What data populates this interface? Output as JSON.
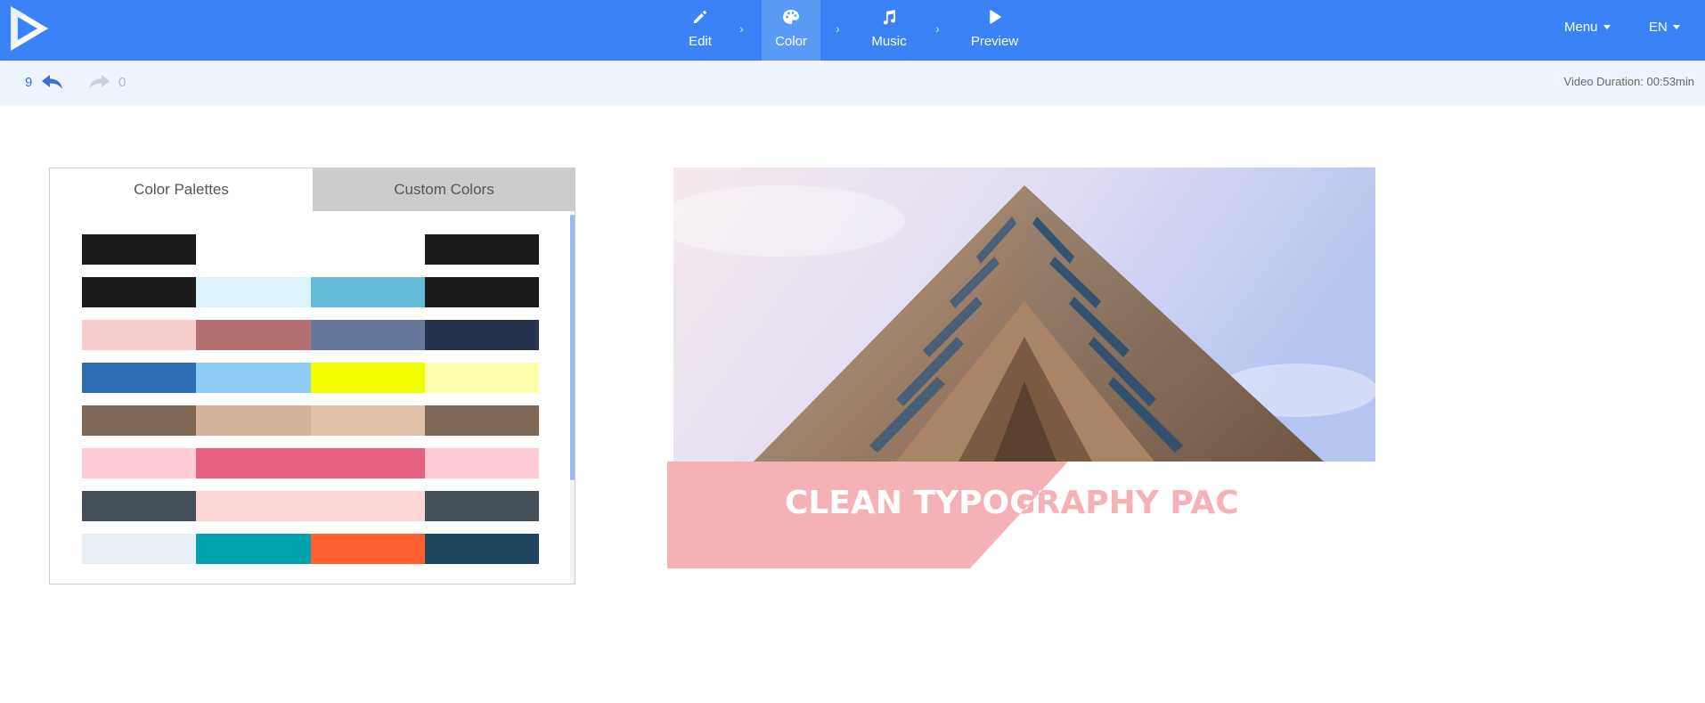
{
  "app": {
    "steps": [
      {
        "label": "Edit",
        "icon": "pencil-icon",
        "active": false
      },
      {
        "label": "Color",
        "icon": "palette-icon",
        "active": true
      },
      {
        "label": "Music",
        "icon": "music-note-icon",
        "active": false
      },
      {
        "label": "Preview",
        "icon": "play-icon",
        "active": false
      }
    ],
    "menu_label": "Menu",
    "language_label": "EN",
    "accent_color": "#3b82f6"
  },
  "history": {
    "undo_count": "9",
    "redo_count": "0",
    "video_duration": "Video Duration: 00:53min"
  },
  "palette_panel": {
    "tabs": [
      {
        "label": "Color Palettes",
        "active": true
      },
      {
        "label": "Custom Colors",
        "active": false
      }
    ],
    "palettes": [
      [
        "#1b1b1b",
        "#ffffff",
        "#ffffff",
        "#1b1b1b"
      ],
      [
        "#1b1b1b",
        "#dcf3fd",
        "#64bcd8",
        "#1b1b1b"
      ],
      [
        "#f7cccd",
        "#b56f72",
        "#66789c",
        "#26344d"
      ],
      [
        "#2f6db3",
        "#8ecbf6",
        "#f2ff00",
        "#feffa8"
      ],
      [
        "#7d6857",
        "#d6b19b",
        "#e3c0aa",
        "#7d6857"
      ],
      [
        "#ffcbd6",
        "#e65f80",
        "#e65f80",
        "#ffcbd6"
      ],
      [
        "#454f5a",
        "#fed5d6",
        "#fed5d6",
        "#454f5a"
      ],
      [
        "#e8eef6",
        "#00a3ad",
        "#ff5e2d",
        "#1d4560"
      ]
    ]
  },
  "preview": {
    "title": "CLEAN TYPOGRAPHY PACK",
    "banner_color": "#f5b2b6"
  }
}
